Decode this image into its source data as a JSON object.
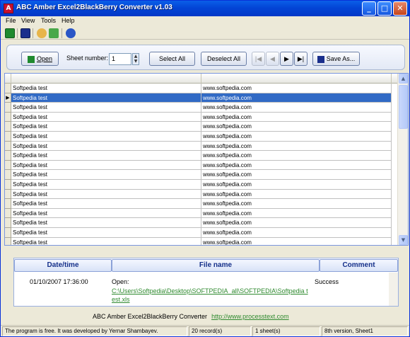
{
  "window": {
    "title": "ABC Amber Excel2BlackBerry Converter v1.03",
    "controls": {
      "minimize": "_",
      "maximize": "□",
      "close": "✕"
    }
  },
  "menu": [
    "File",
    "View",
    "Tools",
    "Help"
  ],
  "toolbar": {
    "icons": [
      "excel-open-icon",
      "blackberry-icon",
      "hand-icon",
      "abc-check-icon",
      "info-icon"
    ]
  },
  "controls": {
    "open_label": "Open",
    "sheet_number_label": "Sheet number:",
    "sheet_number_value": "1",
    "select_all_label": "Select All",
    "deselect_all_label": "Deselect All",
    "nav_first": "|◀",
    "nav_prev": "◀",
    "nav_next": "▶",
    "nav_last": "▶|",
    "save_as_label": "Save As..."
  },
  "grid": {
    "rows": [
      [
        "Softpedia test",
        "www.softpedia.com"
      ],
      [
        "Softpedia test",
        "www.softpedia.com"
      ],
      [
        "Softpedia test",
        "www.softpedia.com"
      ],
      [
        "Softpedia test",
        "www.softpedia.com"
      ],
      [
        "Softpedia test",
        "www.softpedia.com"
      ],
      [
        "Softpedia test",
        "www.softpedia.com"
      ],
      [
        "Softpedia test",
        "www.softpedia.com"
      ],
      [
        "Softpedia test",
        "www.softpedia.com"
      ],
      [
        "Softpedia test",
        "www.softpedia.com"
      ],
      [
        "Softpedia test",
        "www.softpedia.com"
      ],
      [
        "Softpedia test",
        "www.softpedia.com"
      ],
      [
        "Softpedia test",
        "www.softpedia.com"
      ],
      [
        "Softpedia test",
        "www.softpedia.com"
      ],
      [
        "Softpedia test",
        "www.softpedia.com"
      ],
      [
        "Softpedia test",
        "www.softpedia.com"
      ],
      [
        "Softpedia test",
        "www.softpedia.com"
      ],
      [
        "Softpedia test",
        "www.softpedia.com"
      ]
    ],
    "selected_row": 1,
    "current_row_marker": "▶"
  },
  "log": {
    "headers": {
      "date": "Date/time",
      "file": "File name",
      "comment": "Comment"
    },
    "entry": {
      "date": "01/10/2007 17:36:00",
      "action": "Open:",
      "path": "C:\\Users\\Softpedia\\Desktop\\SOFTPEDIA_all\\SOFTPEDIA\\Softpedia test.xls",
      "comment": "Success"
    }
  },
  "footer": {
    "product": "ABC Amber Excel2BlackBerry Converter",
    "url": "http://www.processtext.com"
  },
  "status": {
    "message": "The program is free. It was developed by Yernar Shambayev.",
    "records": "20 record(s)",
    "sheets": "1 sheet(s)",
    "version": "8th version, Sheet1"
  },
  "colors": {
    "titlebar": "#0345d6",
    "selection": "#316ac5",
    "link": "#2f8a2f",
    "log_header_text": "#15308a"
  }
}
